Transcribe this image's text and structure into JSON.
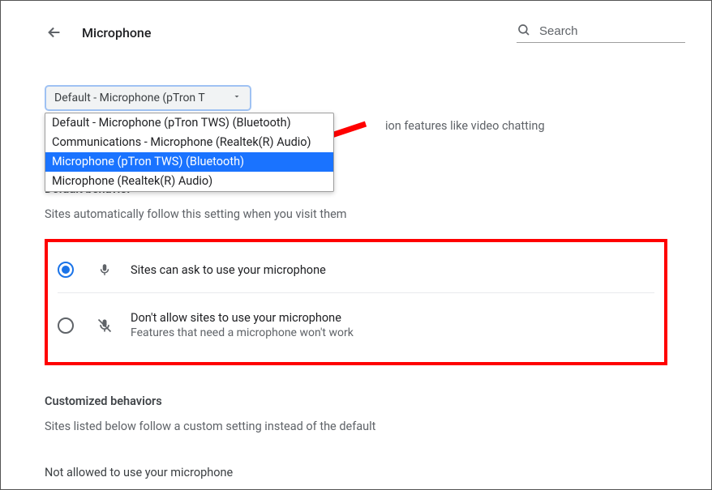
{
  "header": {
    "title": "Microphone",
    "search_placeholder": "Search"
  },
  "device_select": {
    "current": "Default - Microphone (pTron T",
    "options": [
      "Default - Microphone (pTron TWS) (Bluetooth)",
      "Communications - Microphone (Realtek(R) Audio)",
      "Microphone (pTron TWS) (Bluetooth)",
      "Microphone (Realtek(R) Audio)"
    ],
    "highlighted_index": 2
  },
  "hint_fragment": "ion features like video chatting",
  "default_behavior": {
    "heading": "Default behavior",
    "sub": "Sites automatically follow this setting when you visit them",
    "options": [
      {
        "label": "Sites can ask to use your microphone",
        "sub": "",
        "selected": true,
        "icon": "mic"
      },
      {
        "label": "Don't allow sites to use your microphone",
        "sub": "Features that need a microphone won't work",
        "selected": false,
        "icon": "mic-off"
      }
    ]
  },
  "custom": {
    "heading": "Customized behaviors",
    "sub": "Sites listed below follow a custom setting instead of the default",
    "not_allowed_heading": "Not allowed to use your microphone"
  }
}
